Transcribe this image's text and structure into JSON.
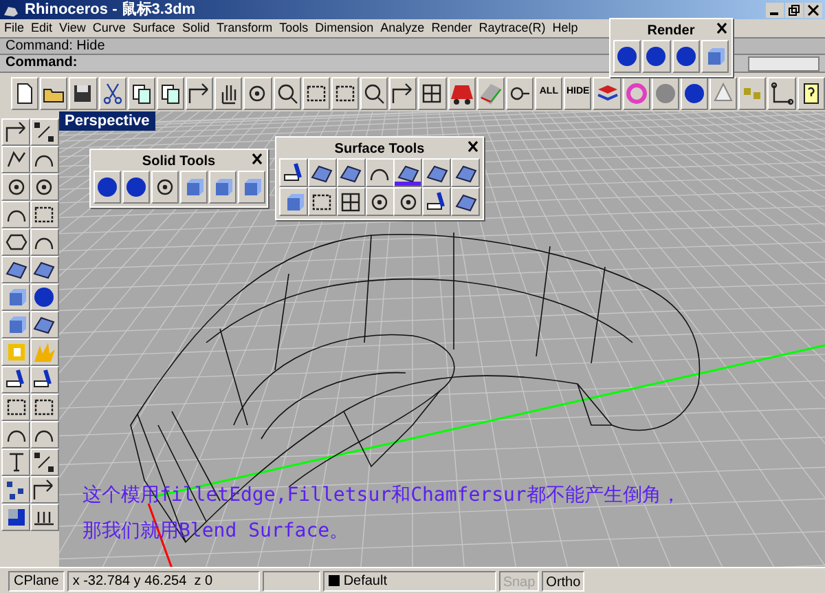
{
  "window": {
    "title": "Rhinoceros - 鼠标3.3dm"
  },
  "menu": [
    "File",
    "Edit",
    "View",
    "Curve",
    "Surface",
    "Solid",
    "Transform",
    "Tools",
    "Dimension",
    "Analyze",
    "Render",
    "Raytrace(R)",
    "Help"
  ],
  "command_history": "Command: Hide",
  "command_prompt": "Command:",
  "toolbar": {
    "text_buttons": [
      "ALL",
      "HIDE"
    ]
  },
  "viewport": {
    "title": "Perspective"
  },
  "render_panel": {
    "title": "Render"
  },
  "solid_tools": {
    "title": "Solid Tools"
  },
  "surface_tools": {
    "title": "Surface Tools",
    "tools": [
      {
        "selected": false
      },
      {
        "selected": false
      },
      {
        "selected": false
      },
      {
        "selected": false
      },
      {
        "selected": true
      },
      {
        "selected": false
      },
      {
        "selected": false
      },
      {
        "selected": false
      },
      {
        "selected": false
      },
      {
        "selected": false
      },
      {
        "selected": false
      },
      {
        "selected": false
      },
      {
        "selected": false
      },
      {
        "selected": false
      }
    ]
  },
  "caption": [
    "这个模用filletEdge,Filletsur和Chamfersur都不能产生倒角，",
    "那我们就用Blend Surface。"
  ],
  "status_bar": {
    "cplane": "CPlane",
    "coordinates": "x -32.784 y 46.254  z 0",
    "layer": {
      "name": "Default",
      "color": "#000000"
    },
    "toggles": [
      {
        "label": "Snap",
        "on": false
      },
      {
        "label": "Ortho",
        "on": true
      }
    ]
  }
}
